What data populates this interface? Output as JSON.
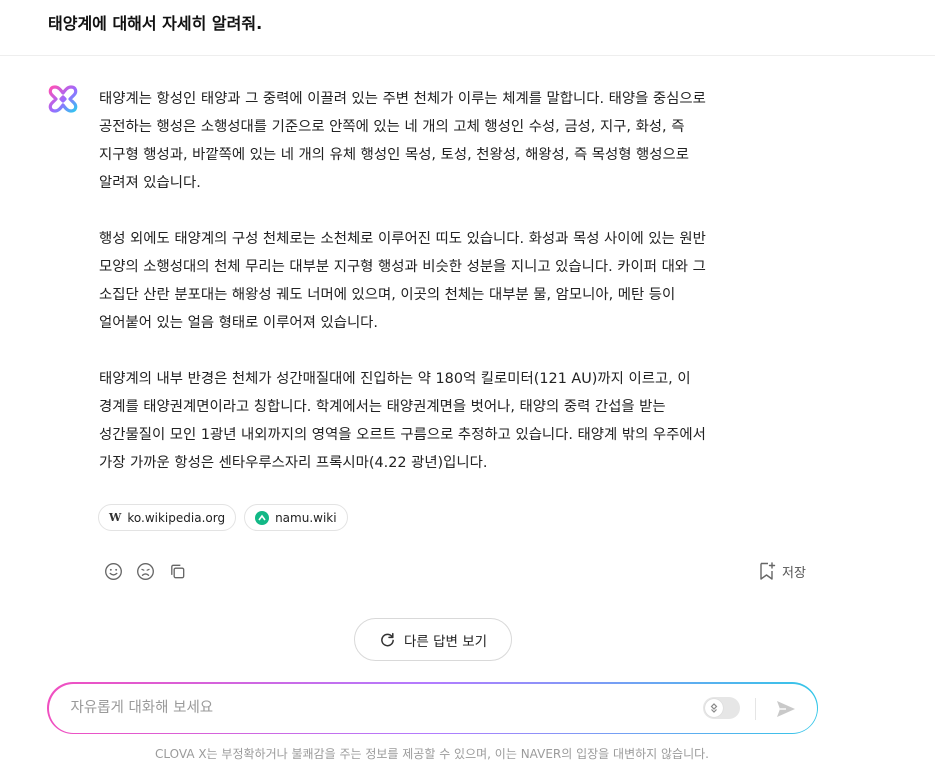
{
  "header": {
    "title": "태양계에 대해서 자세히 알려줘."
  },
  "answer": {
    "p1": [
      "태양계는 항성인 태양과 그 중력에 이끌려 있는 주변 천체가 이루는 체계를 말합니다. 태양을 중심으로",
      "공전하는 행성은 소행성대를 기준으로 안쪽에 있는 네 개의 고체 행성인 수성, 금성, 지구, 화성, 즉",
      "지구형 행성과, 바깥쪽에 있는 네 개의 유체 행성인 목성, 토성, 천왕성, 해왕성, 즉 목성형 행성으로",
      "알려져 있습니다."
    ],
    "p2": [
      "행성 외에도 태양계의 구성 천체로는 소천체로 이루어진 띠도 있습니다. 화성과 목성 사이에 있는 원반",
      "모양의 소행성대의 천체 무리는 대부분 지구형 행성과 비슷한 성분을 지니고 있습니다. 카이퍼 대와 그",
      "소집단 산란 분포대는 해왕성 궤도 너머에 있으며, 이곳의 천체는 대부분 물, 암모니아, 메탄 등이",
      "얼어붙어 있는 얼음 형태로 이루어져 있습니다."
    ],
    "p3": [
      "태양계의 내부 반경은 천체가 성간매질대에 진입하는 약 180억 킬로미터(121 AU)까지 이르고, 이",
      "경계를 태양권계면이라고 칭합니다. 학계에서는 태양권계면을 벗어나, 태양의 중력 간섭을 받는",
      "성간물질이 모인 1광년 내외까지의 영역을 오르트 구름으로 추정하고 있습니다. 태양계 밖의 우주에서",
      "가장 가까운 항성은 센타우루스자리 프록시마(4.22 광년)입니다."
    ]
  },
  "sources": [
    {
      "label": "ko.wikipedia.org",
      "icon": "wikipedia-icon"
    },
    {
      "label": "namu.wiki",
      "icon": "namuwiki-icon"
    }
  ],
  "actions": {
    "icons": [
      "smile-icon",
      "sad-icon",
      "copy-icon"
    ],
    "save_label": "저장"
  },
  "regenerate": {
    "label": "다른 답변 보기"
  },
  "input": {
    "placeholder": "자유롭게 대화해 보세요",
    "value": ""
  },
  "disclaimer": "CLOVA X는 부정확하거나 불쾌감을 주는 정보를 제공할 수 있으며, 이는 NAVER의 입장을 대변하지 않습니다.",
  "colors": {
    "gradient_start": "#f04fc0",
    "gradient_mid": "#b27cff",
    "gradient_end": "#34c6e8",
    "namu_green": "#12b886"
  }
}
